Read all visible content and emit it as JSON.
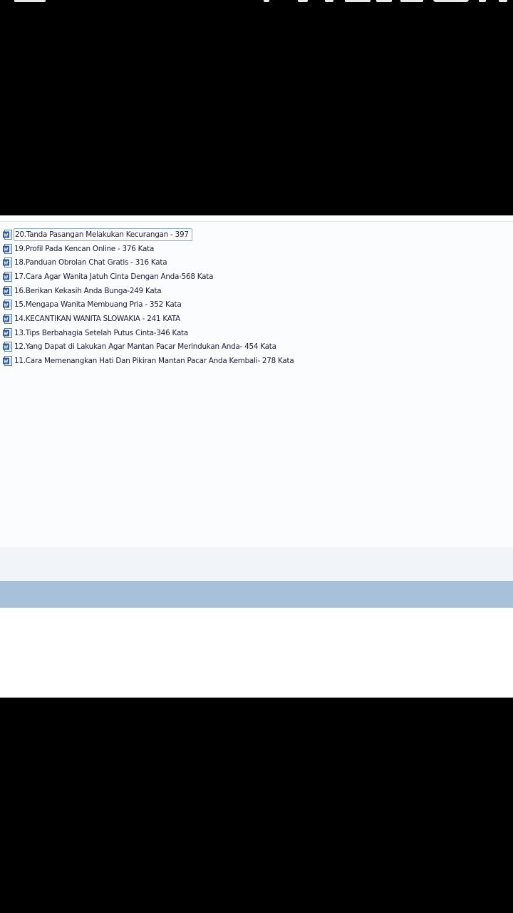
{
  "files": [
    {
      "name": "20.Tanda Pasangan Melakukan Kecurangan - 397",
      "selected": true
    },
    {
      "name": "19.Profil Pada Kencan Online - 376 Kata"
    },
    {
      "name": "18.Panduan Obrolan Chat Gratis - 316 Kata"
    },
    {
      "name": "17.Cara Agar Wanita Jatuh Cinta Dengan Anda-568 Kata"
    },
    {
      "name": "16.Berikan Kekasih Anda Bunga-249 Kata"
    },
    {
      "name": "15.Mengapa Wanita Membuang Pria - 352 Kata"
    },
    {
      "name": "14.KECANTIKAN WANITA SLOWAKIA - 241 KATA"
    },
    {
      "name": "13.Tips Berbahagia Setelah Putus Cinta-346 Kata"
    },
    {
      "name": "12.Yang Dapat di Lakukan Agar Mantan Pacar Merindukan Anda- 454 Kata"
    },
    {
      "name": "11.Cara Memenangkan Hati Dan Pikiran Mantan Pacar Anda Kembali- 278 Kata"
    }
  ],
  "icons": {
    "file": "word-document-icon"
  },
  "colors": {
    "background": "#000000",
    "content": "#ffffff",
    "panel": "#fbfcfe",
    "text": "#1b1b3a",
    "selection_border": "#8aa9c9",
    "details_pane": "#f1f4f8",
    "taskbar": "#a7c1da"
  }
}
